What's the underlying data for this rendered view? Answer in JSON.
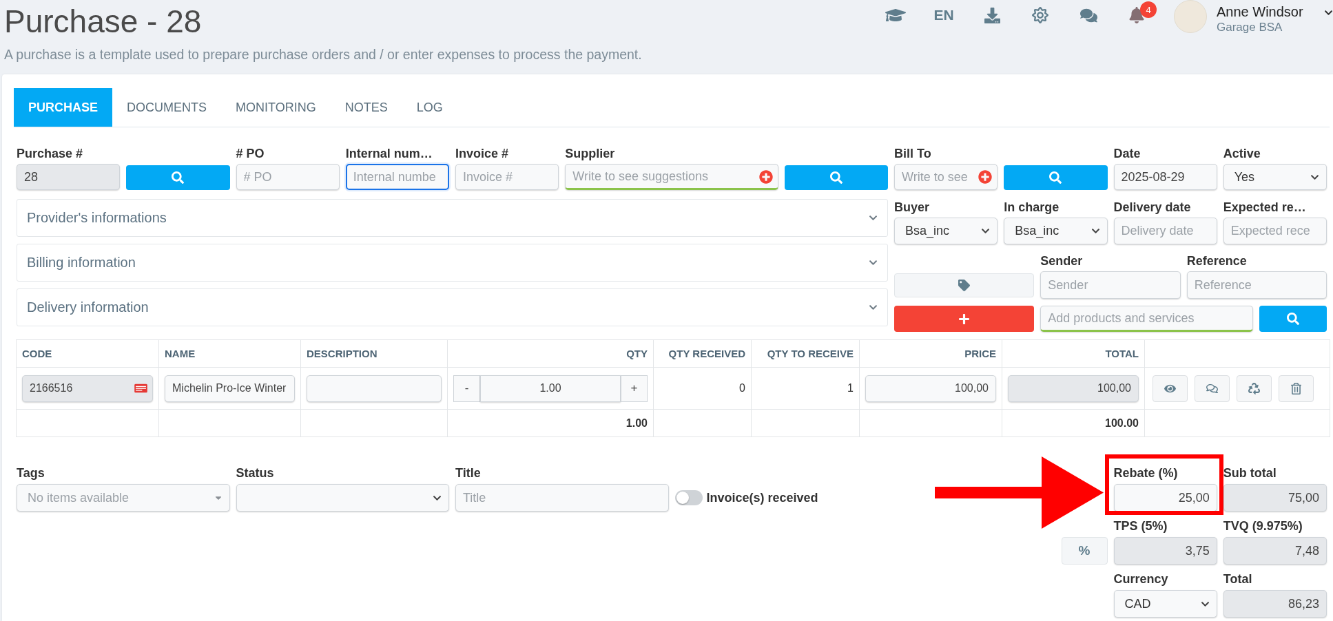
{
  "header": {
    "title": "Purchase - 28",
    "subtitle": "A purchase is a template used to prepare purchase orders and / or enter expenses to process the payment.",
    "language": "EN",
    "notification_count": "4",
    "user": {
      "name": "Anne Windsor",
      "company": "Garage BSA"
    }
  },
  "tabs": [
    {
      "label": "PURCHASE",
      "selected": true
    },
    {
      "label": "DOCUMENTS",
      "selected": false
    },
    {
      "label": "MONITORING",
      "selected": false
    },
    {
      "label": "NOTES",
      "selected": false
    },
    {
      "label": "LOG",
      "selected": false
    }
  ],
  "main": {
    "purchase_number": {
      "label": "Purchase #",
      "value": "28"
    },
    "po_number": {
      "label": "# PO",
      "placeholder": "# PO"
    },
    "internal_number": {
      "label": "Internal num…",
      "placeholder": "Internal numbe",
      "focused": true
    },
    "invoice_number": {
      "label": "Invoice #",
      "placeholder": "Invoice #"
    },
    "supplier": {
      "label": "Supplier",
      "placeholder": "Write to see suggestions"
    },
    "bill_to": {
      "label": "Bill To",
      "placeholder": "Write to see"
    },
    "date": {
      "label": "Date",
      "value": "2025-08-29"
    },
    "active": {
      "label": "Active",
      "value": "Yes"
    }
  },
  "sections": [
    {
      "title": "Provider's informations",
      "expanded": false
    },
    {
      "title": "Billing information",
      "expanded": false
    },
    {
      "title": "Delivery information",
      "expanded": false
    }
  ],
  "assignment": {
    "buyer": {
      "label": "Buyer",
      "value": "Bsa_inc"
    },
    "in_charge": {
      "label": "In charge",
      "value": "Bsa_inc"
    },
    "delivery_date": {
      "label": "Delivery date",
      "placeholder": "Delivery date"
    },
    "expected_reception": {
      "label": "Expected re…",
      "placeholder": "Expected rece"
    },
    "sender": {
      "label": "Sender",
      "placeholder": "Sender"
    },
    "reference": {
      "label": "Reference",
      "placeholder": "Reference"
    },
    "product_search": {
      "placeholder": "Add products and services"
    }
  },
  "table": {
    "columns": [
      {
        "label": "CODE",
        "kind": "text"
      },
      {
        "label": "NAME",
        "kind": "text"
      },
      {
        "label": "DESCRIPTION",
        "kind": "text"
      },
      {
        "label": "QTY",
        "kind": "number"
      },
      {
        "label": "QTY RECEIVED",
        "kind": "number"
      },
      {
        "label": "QTY TO RECEIVE",
        "kind": "number"
      },
      {
        "label": "PRICE",
        "kind": "number"
      },
      {
        "label": "TOTAL",
        "kind": "number"
      }
    ],
    "rows": [
      {
        "code": "2166516",
        "name": "Michelin Pro-Ice Winter",
        "minus": "-",
        "qty": "1.00",
        "plus": "+",
        "qty_received": "0",
        "qty_to_receive": "1",
        "price": "100,00",
        "total": "100,00"
      }
    ],
    "totals": {
      "qty": "1.00",
      "total": "100.00"
    }
  },
  "details": {
    "tags": {
      "label": "Tags",
      "placeholder": "No items available"
    },
    "status": {
      "label": "Status"
    },
    "title": {
      "label": "Title",
      "placeholder": "Title"
    },
    "invoice_received": {
      "label": "Invoice(s) received",
      "on": false
    }
  },
  "amounts": {
    "rebate": {
      "label": "Rebate (%)",
      "value": "25,00",
      "highlighted": true
    },
    "subtotal": {
      "label": "Sub total",
      "value": "75,00"
    },
    "percent_button": "%",
    "tps": {
      "label": "TPS (5%)",
      "value": "3,75"
    },
    "tvq": {
      "label": "TVQ (9.975%)",
      "value": "7,48"
    },
    "currency": {
      "label": "Currency",
      "value": "CAD"
    },
    "total": {
      "label": "Total",
      "value": "86,23"
    }
  }
}
